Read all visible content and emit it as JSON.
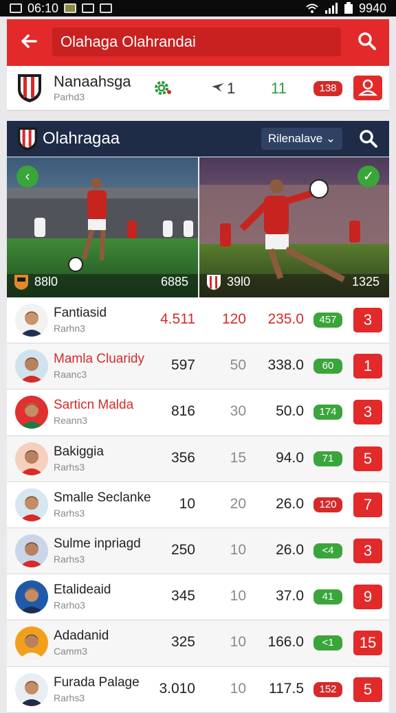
{
  "status_bar": {
    "time": "06:10",
    "battery": "9940"
  },
  "top_bar": {
    "title": "Olahaga Olahrandai"
  },
  "match_bar": {
    "team": "Nanaahsga",
    "subtitle": "Parhd3",
    "count": "1",
    "green_value": "11",
    "badge": "138"
  },
  "panel": {
    "title": "Olahragaa",
    "dropdown_selected": "Rilenalave ⌄"
  },
  "hero": {
    "left": {
      "stat_a": "88l0",
      "stat_b": "6885"
    },
    "right": {
      "stat_a": "39l0",
      "stat_b": "1325"
    }
  },
  "players": [
    {
      "name": "Fantiasid",
      "sub": "Rarhn3",
      "v1": "4.511",
      "v2": "120",
      "v3": "235.0",
      "pill": "457",
      "pill_color": "green",
      "rank": "3",
      "name_red": false,
      "values_red": true,
      "avatar_bg": "#f2f2f2",
      "shirt": "#223054",
      "skin": "#c9936b",
      "hair": "#2b1d17"
    },
    {
      "name": "Mamla Cluaridy",
      "sub": "Raanc3",
      "v1": "597",
      "v2": "50",
      "v3": "338.0",
      "pill": "60",
      "pill_color": "green",
      "rank": "1",
      "name_red": true,
      "values_red": false,
      "avatar_bg": "#cfe3ee",
      "shirt": "#d92a2a",
      "skin": "#b8825e",
      "hair": "#1b1411"
    },
    {
      "name": "Sarticn Malda",
      "sub": "Reann3",
      "v1": "816",
      "v2": "30",
      "v3": "50.0",
      "pill": "174",
      "pill_color": "green",
      "rank": "3",
      "name_red": true,
      "values_red": false,
      "avatar_bg": "#e03030",
      "shirt": "#1b7d45",
      "skin": "#c48d63",
      "hair": "#1b1411"
    },
    {
      "name": "Bakiggia",
      "sub": "Rarhs3",
      "v1": "356",
      "v2": "15",
      "v3": "94.0",
      "pill": "71",
      "pill_color": "green",
      "rank": "5",
      "name_red": false,
      "values_red": false,
      "avatar_bg": "#f7cfbd",
      "shirt": "#d92a2a",
      "skin": "#b8825e",
      "hair": "#1b1411"
    },
    {
      "name": "Smalle Seclanke",
      "sub": "Rarhs3",
      "v1": "10",
      "v2": "20",
      "v3": "26.0",
      "pill": "120",
      "pill_color": "red",
      "rank": "7",
      "name_red": false,
      "values_red": false,
      "avatar_bg": "#d6e7ef",
      "shirt": "#d92a2a",
      "skin": "#c48d63",
      "hair": "#1b1411"
    },
    {
      "name": "Sulme inpriagd",
      "sub": "Rarhs3",
      "v1": "250",
      "v2": "10",
      "v3": "26.0",
      "pill": "<4",
      "pill_color": "green",
      "rank": "3",
      "name_red": false,
      "values_red": false,
      "avatar_bg": "#c8d6ea",
      "shirt": "#d92a2a",
      "skin": "#b8825e",
      "hair": "#1b1411"
    },
    {
      "name": "Etalideaid",
      "sub": "Rarho3",
      "v1": "345",
      "v2": "10",
      "v3": "37.0",
      "pill": "41",
      "pill_color": "green",
      "rank": "9",
      "name_red": false,
      "values_red": false,
      "avatar_bg": "#1e5aa8",
      "shirt": "#1d2d50",
      "skin": "#c48d63",
      "hair": "#1b1411"
    },
    {
      "name": "Adadanid",
      "sub": "Camm3",
      "v1": "325",
      "v2": "10",
      "v3": "166.0",
      "pill": "<1",
      "pill_color": "green",
      "rank": "15",
      "name_red": false,
      "values_red": false,
      "avatar_bg": "#f2a01c",
      "shirt": "#f4f4f4",
      "skin": "#b8825e",
      "hair": "#1b1411"
    },
    {
      "name": "Furada Palage",
      "sub": "Rarhs3",
      "v1": "3.010",
      "v2": "10",
      "v3": "117.5",
      "pill": "152",
      "pill_color": "red",
      "rank": "5",
      "name_red": false,
      "values_red": false,
      "avatar_bg": "#e8eef2",
      "shirt": "#1e2c47",
      "skin": "#c48d63",
      "hair": "#1b1411"
    }
  ]
}
